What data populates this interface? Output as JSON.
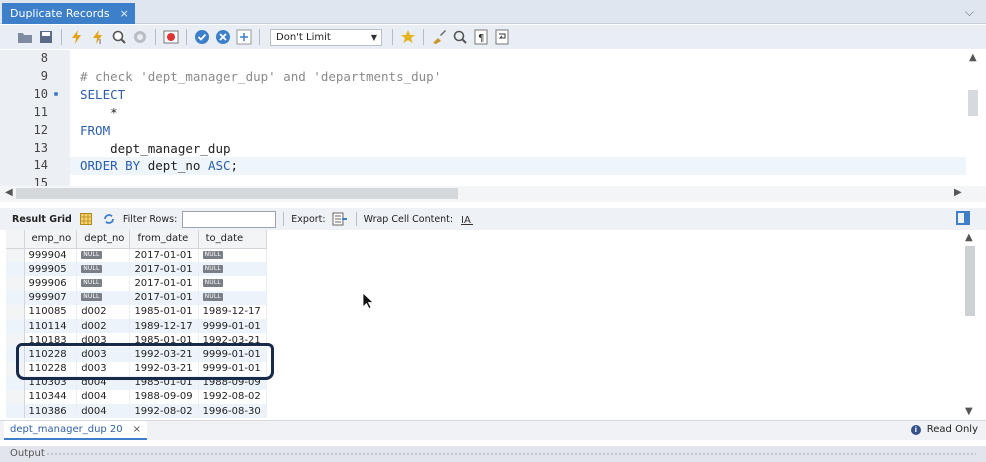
{
  "tab": {
    "title": "Duplicate Records",
    "close": "×"
  },
  "toolbar": {
    "limit_value": "Don't Limit"
  },
  "editor": {
    "line_numbers": [
      "8",
      "9",
      "10",
      "11",
      "12",
      "13",
      "14",
      "15"
    ],
    "lines": [
      "",
      "# check 'dept_manager_dup' and 'departments_dup'",
      "SELECT",
      "    *",
      "FROM",
      "    dept_manager_dup",
      "ORDER BY dept_no ASC;",
      ""
    ]
  },
  "result_toolbar": {
    "result_grid": "Result Grid",
    "filter_rows": "Filter Rows:",
    "filter_value": "",
    "export": "Export:",
    "wrap": "Wrap Cell Content:"
  },
  "grid": {
    "columns": [
      "emp_no",
      "dept_no",
      "from_date",
      "to_date"
    ],
    "null_label": "NULL",
    "rows": [
      [
        "999904",
        null,
        "2017-01-01",
        null
      ],
      [
        "999905",
        null,
        "2017-01-01",
        null
      ],
      [
        "999906",
        null,
        "2017-01-01",
        null
      ],
      [
        "999907",
        null,
        "2017-01-01",
        null
      ],
      [
        "110085",
        "d002",
        "1985-01-01",
        "1989-12-17"
      ],
      [
        "110114",
        "d002",
        "1989-12-17",
        "9999-01-01"
      ],
      [
        "110183",
        "d003",
        "1985-01-01",
        "1992-03-21"
      ],
      [
        "110228",
        "d003",
        "1992-03-21",
        "9999-01-01"
      ],
      [
        "110228",
        "d003",
        "1992-03-21",
        "9999-01-01"
      ],
      [
        "110303",
        "d004",
        "1985-01-01",
        "1988-09-09"
      ],
      [
        "110344",
        "d004",
        "1988-09-09",
        "1992-08-02"
      ],
      [
        "110386",
        "d004",
        "1992-08-02",
        "1996-08-30"
      ]
    ]
  },
  "result_tab": {
    "label": "dept_manager_dup 20",
    "close": "×"
  },
  "status": {
    "read_only": "Read Only"
  },
  "output": {
    "label": "Output"
  },
  "colors": {
    "accent": "#3d80c9",
    "annotation": "#182a4a"
  }
}
